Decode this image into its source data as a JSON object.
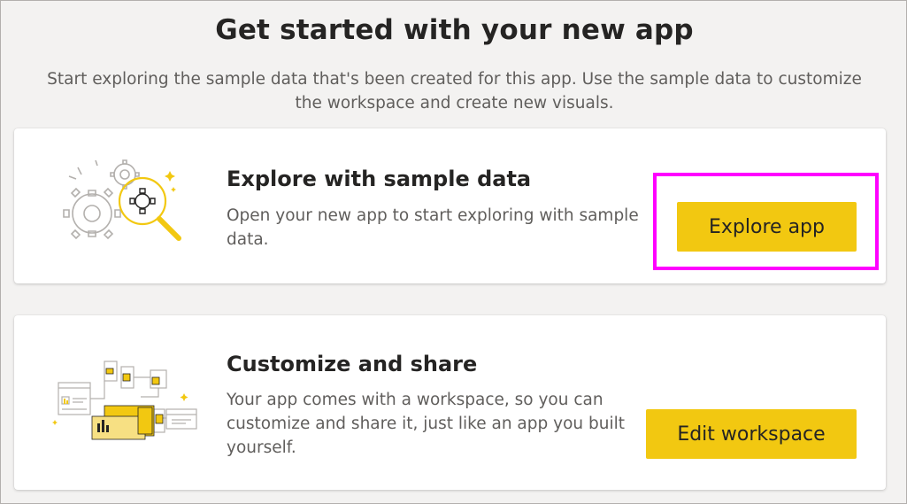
{
  "page": {
    "title": "Get started with your new app",
    "subtitle": "Start exploring the sample data that's been created for this app. Use the sample data to customize the workspace and create new visuals."
  },
  "cards": [
    {
      "title": "Explore with sample data",
      "description": "Open your new app to start exploring with sample data.",
      "button_label": "Explore app",
      "illustration": "magnifier-gears-icon"
    },
    {
      "title": "Customize and share",
      "description": "Your app comes with a workspace, so you can customize and share it, just like an app you built yourself.",
      "button_label": "Edit workspace",
      "illustration": "workspace-dashboards-icon"
    }
  ],
  "colors": {
    "accent": "#f2c811",
    "highlight": "#ff00ff",
    "text": "#252423",
    "muted_text": "#605e5c",
    "background": "#f3f2f1"
  }
}
